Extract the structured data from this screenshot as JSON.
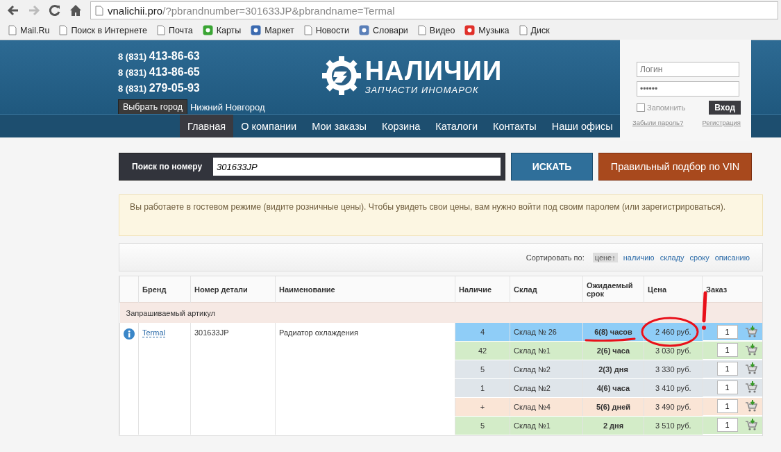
{
  "browser": {
    "url_host": "vnalichii.pro",
    "url_path": "/?pbrandnumber=301633JP&pbrandname=Termal",
    "bookmarks": [
      {
        "label": "Mail.Ru",
        "kind": "page"
      },
      {
        "label": "Поиск в Интернете",
        "kind": "page"
      },
      {
        "label": "Почта",
        "kind": "page"
      },
      {
        "label": "Карты",
        "kind": "favicon",
        "color": "#3aa534"
      },
      {
        "label": "Маркет",
        "kind": "favicon",
        "color": "#3b6ab0"
      },
      {
        "label": "Новости",
        "kind": "page"
      },
      {
        "label": "Словари",
        "kind": "favicon",
        "color": "#5a7fb8"
      },
      {
        "label": "Видео",
        "kind": "page"
      },
      {
        "label": "Музыка",
        "kind": "favicon",
        "color": "#e0302a"
      },
      {
        "label": "Диск",
        "kind": "page"
      }
    ]
  },
  "header": {
    "phones": [
      {
        "code": "8 (831)",
        "number": "413-86-63"
      },
      {
        "code": "8 (831)",
        "number": "413-86-65"
      },
      {
        "code": "8 (831)",
        "number": "279-05-93"
      }
    ],
    "city_button": "Выбрать город",
    "city": "Нижний Новгород",
    "logo_title": "НАЛИЧИИ",
    "logo_subtitle": "ЗАПЧАСТИ ИНОМАРОК"
  },
  "login": {
    "login_placeholder": "Логин",
    "password_value": "••••••",
    "remember": {
      "label": "Запомнить",
      "checked": false
    },
    "submit": "Вход",
    "forgot": "Забыли пароль?",
    "register": "Регистрация"
  },
  "nav": [
    {
      "label": "Главная",
      "selected": true
    },
    {
      "label": "О компании",
      "selected": false
    },
    {
      "label": "Мои заказы",
      "selected": false
    },
    {
      "label": "Корзина",
      "selected": false
    },
    {
      "label": "Каталоги",
      "selected": false
    },
    {
      "label": "Контакты",
      "selected": false
    },
    {
      "label": "Наши офисы",
      "selected": false
    }
  ],
  "search": {
    "label": "Поиск по номеру",
    "value": "301633JP",
    "button": "ИСКАТЬ",
    "vin_button": "Правильный подбор по VIN"
  },
  "notice": "Вы работаете в гостевом режиме (видите розничные цены). Чтобы увидеть свои цены, вам нужно войти под своим паролем (или зарегистрироваться).",
  "sort": {
    "label": "Сортировать по:",
    "options": [
      {
        "label": "цене↑",
        "selected": true
      },
      {
        "label": "наличию",
        "selected": false
      },
      {
        "label": "складу",
        "selected": false
      },
      {
        "label": "сроку",
        "selected": false
      },
      {
        "label": "описанию",
        "selected": false
      }
    ]
  },
  "table": {
    "columns": [
      "Бренд",
      "Номер детали",
      "Наименование",
      "Наличие",
      "Склад",
      "Ожидаемый срок",
      "Цена",
      "Заказ"
    ],
    "group": "Запрашиваемый артикул",
    "brand": "Termal",
    "part_number": "301633JP",
    "name": "Радиатор охлаждения",
    "rows": [
      {
        "stock": "4",
        "warehouse": "Склад № 26",
        "term": "6(8) часов",
        "price": "2 460 руб.",
        "qty": "1",
        "color": "#8fcdf7"
      },
      {
        "stock": "42",
        "warehouse": "Склад №1",
        "term": "2(6) часа",
        "price": "3 030 руб.",
        "qty": "1",
        "color": "#d3ecc8"
      },
      {
        "stock": "5",
        "warehouse": "Склад №2",
        "term": "2(3) дня",
        "price": "3 330 руб.",
        "qty": "1",
        "color": "#dfe5ea"
      },
      {
        "stock": "1",
        "warehouse": "Склад №2",
        "term": "4(6) часа",
        "price": "3 410 руб.",
        "qty": "1",
        "color": "#dfe5ea"
      },
      {
        "stock": "+",
        "warehouse": "Склад №4",
        "term": "5(6) дней",
        "price": "3 490 руб.",
        "qty": "1",
        "color": "#fae5d6"
      },
      {
        "stock": "5",
        "warehouse": "Склад №1",
        "term": "2 дня",
        "price": "3 510 руб.",
        "qty": "1",
        "color": "#d3ecc8"
      }
    ]
  }
}
